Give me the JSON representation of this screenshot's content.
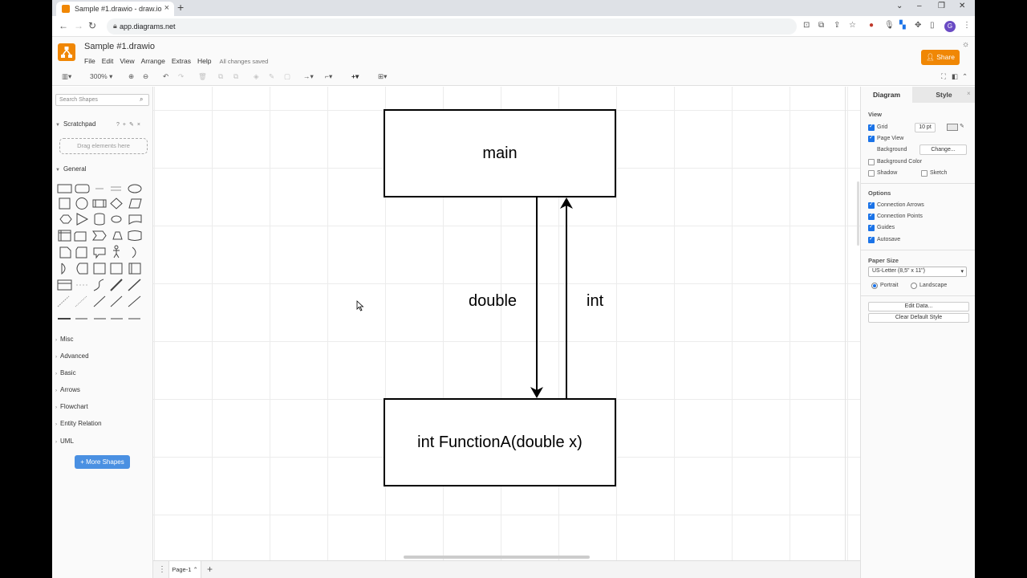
{
  "browser": {
    "tab_title": "Sample #1.drawio - draw.io",
    "url": "app.diagrams.net",
    "profile_initial": "G"
  },
  "app": {
    "doc_name": "Sample #1.drawio",
    "menus": [
      "File",
      "Edit",
      "View",
      "Arrange",
      "Extras",
      "Help"
    ],
    "save_status": "All changes saved",
    "share_label": "Share"
  },
  "toolbar": {
    "zoom": "300%"
  },
  "sidebar": {
    "search_placeholder": "Search Shapes",
    "scratchpad_label": "Scratchpad",
    "drop_hint": "Drag elements here",
    "general_label": "General",
    "libraries": [
      "Misc",
      "Advanced",
      "Basic",
      "Arrows",
      "Flowchart",
      "Entity Relation",
      "UML"
    ],
    "more_shapes_label": "+ More Shapes"
  },
  "diagram": {
    "top_box_label": "main",
    "bottom_box_label": "int FunctionA(double x)",
    "down_arrow_label": "double",
    "up_arrow_label": "int"
  },
  "pages": {
    "current": "Page-1"
  },
  "format_panel": {
    "tab_diagram": "Diagram",
    "tab_style": "Style",
    "view_header": "View",
    "grid_label": "Grid",
    "grid_size": "10 pt",
    "page_view_label": "Page View",
    "background_label": "Background",
    "change_label": "Change...",
    "background_color_label": "Background Color",
    "shadow_label": "Shadow",
    "sketch_label": "Sketch",
    "options_header": "Options",
    "options": [
      "Connection Arrows",
      "Connection Points",
      "Guides",
      "Autosave"
    ],
    "paper_size_header": "Paper Size",
    "paper_size_value": "US-Letter (8,5\" x 11\")",
    "portrait_label": "Portrait",
    "landscape_label": "Landscape",
    "edit_data_label": "Edit Data...",
    "clear_style_label": "Clear Default Style"
  }
}
